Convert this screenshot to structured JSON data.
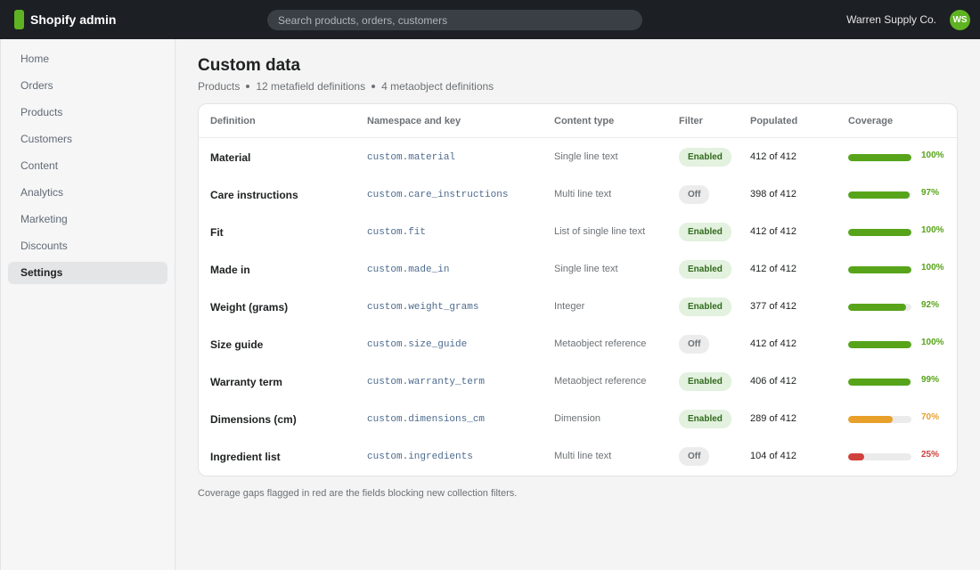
{
  "header": {
    "brand": "Shopify admin",
    "search_placeholder": "Search products, orders, customers",
    "store_name": "Warren Supply Co.",
    "avatar_initials": "WS"
  },
  "sidebar": {
    "items": [
      {
        "label": "Home",
        "active": false
      },
      {
        "label": "Orders",
        "active": false
      },
      {
        "label": "Products",
        "active": false
      },
      {
        "label": "Customers",
        "active": false
      },
      {
        "label": "Content",
        "active": false
      },
      {
        "label": "Analytics",
        "active": false
      },
      {
        "label": "Marketing",
        "active": false
      },
      {
        "label": "Discounts",
        "active": false
      },
      {
        "label": "Settings",
        "active": true
      }
    ]
  },
  "page": {
    "title": "Custom data",
    "breadcrumb": [
      "Products",
      "12 metafield definitions",
      "4 metaobject definitions"
    ]
  },
  "table": {
    "columns": [
      "Definition",
      "Namespace and key",
      "Content type",
      "Filter",
      "Populated",
      "Coverage"
    ],
    "rows": [
      {
        "definition": "Material",
        "key": "custom.material",
        "type": "Single line text",
        "filter": "Enabled",
        "populated": "412 of 412",
        "coverage": 100,
        "coverage_label": "100%",
        "status": "good"
      },
      {
        "definition": "Care instructions",
        "key": "custom.care_instructions",
        "type": "Multi line text",
        "filter": "Off",
        "populated": "398 of 412",
        "coverage": 97,
        "coverage_label": "97%",
        "status": "good"
      },
      {
        "definition": "Fit",
        "key": "custom.fit",
        "type": "List of single line text",
        "filter": "Enabled",
        "populated": "412 of 412",
        "coverage": 100,
        "coverage_label": "100%",
        "status": "good"
      },
      {
        "definition": "Made in",
        "key": "custom.made_in",
        "type": "Single line text",
        "filter": "Enabled",
        "populated": "412 of 412",
        "coverage": 100,
        "coverage_label": "100%",
        "status": "good"
      },
      {
        "definition": "Weight (grams)",
        "key": "custom.weight_grams",
        "type": "Integer",
        "filter": "Enabled",
        "populated": "377 of 412",
        "coverage": 92,
        "coverage_label": "92%",
        "status": "good"
      },
      {
        "definition": "Size guide",
        "key": "custom.size_guide",
        "type": "Metaobject reference",
        "filter": "Off",
        "populated": "412 of 412",
        "coverage": 100,
        "coverage_label": "100%",
        "status": "good"
      },
      {
        "definition": "Warranty term",
        "key": "custom.warranty_term",
        "type": "Metaobject reference",
        "filter": "Enabled",
        "populated": "406 of 412",
        "coverage": 99,
        "coverage_label": "99%",
        "status": "good"
      },
      {
        "definition": "Dimensions (cm)",
        "key": "custom.dimensions_cm",
        "type": "Dimension",
        "filter": "Enabled",
        "populated": "289 of 412",
        "coverage": 70,
        "coverage_label": "70%",
        "status": "warning"
      },
      {
        "definition": "Ingredient list",
        "key": "custom.ingredients",
        "type": "Multi line text",
        "filter": "Off",
        "populated": "104 of 412",
        "coverage": 25,
        "coverage_label": "25%",
        "status": "critical"
      }
    ]
  },
  "footnote": "Coverage gaps flagged in red are the fields blocking new collection filters.",
  "colors": {
    "good": "#57a41a",
    "warning": "#e8a02a",
    "critical": "#d0413d",
    "brand": "#5fb322"
  }
}
